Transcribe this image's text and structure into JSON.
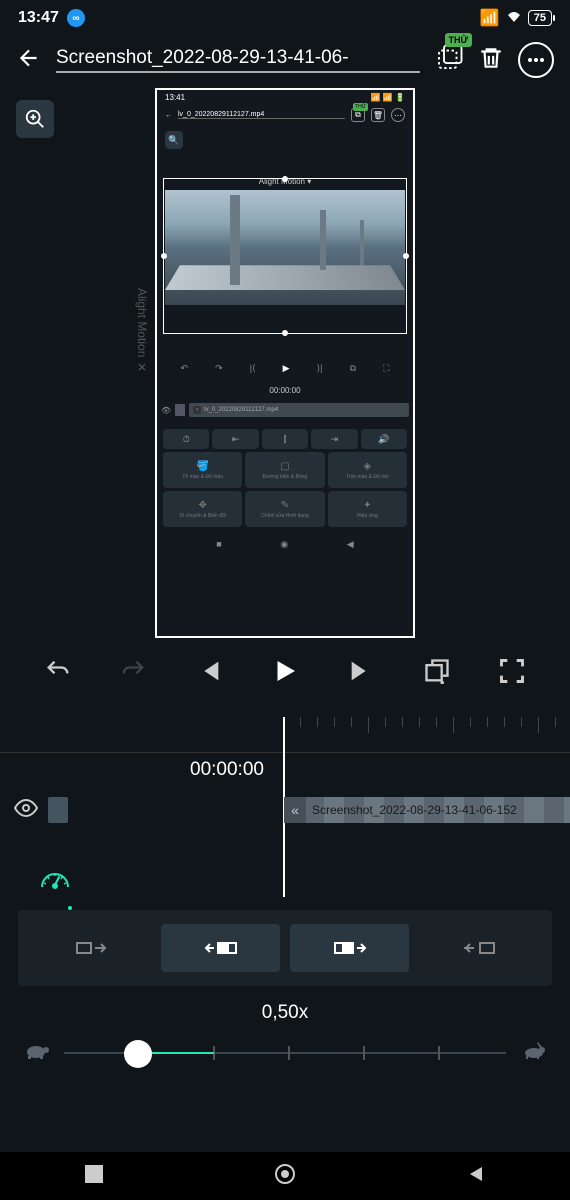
{
  "status": {
    "time": "13:47",
    "battery": "75"
  },
  "header": {
    "title": "Screenshot_2022-08-29-13-41-06-",
    "badge": "THỬ"
  },
  "preview": {
    "status_time": "13:41",
    "filename": "lv_0_20220829112127.mp4",
    "badge": "THỬ",
    "watermark": "Alight Motion ▾",
    "time": "00:00:00",
    "clip_name": "lv_0_20220829112127.mp4",
    "side_label": "Alight Motion ✕",
    "tools": {
      "color": "Tô màu & Đổ màu",
      "border": "Đường biên & Bóng",
      "blend": "Trộn màu & Độ mờ",
      "move": "Di chuyển & Biến đổi",
      "shape": "Chỉnh sửa Hình dạng",
      "effects": "Hiệu ứng"
    }
  },
  "timeline": {
    "time": "00:00:00",
    "clip_name": "Screenshot_2022-08-29-13-41-06-152"
  },
  "speed": {
    "value": "0,50x"
  }
}
